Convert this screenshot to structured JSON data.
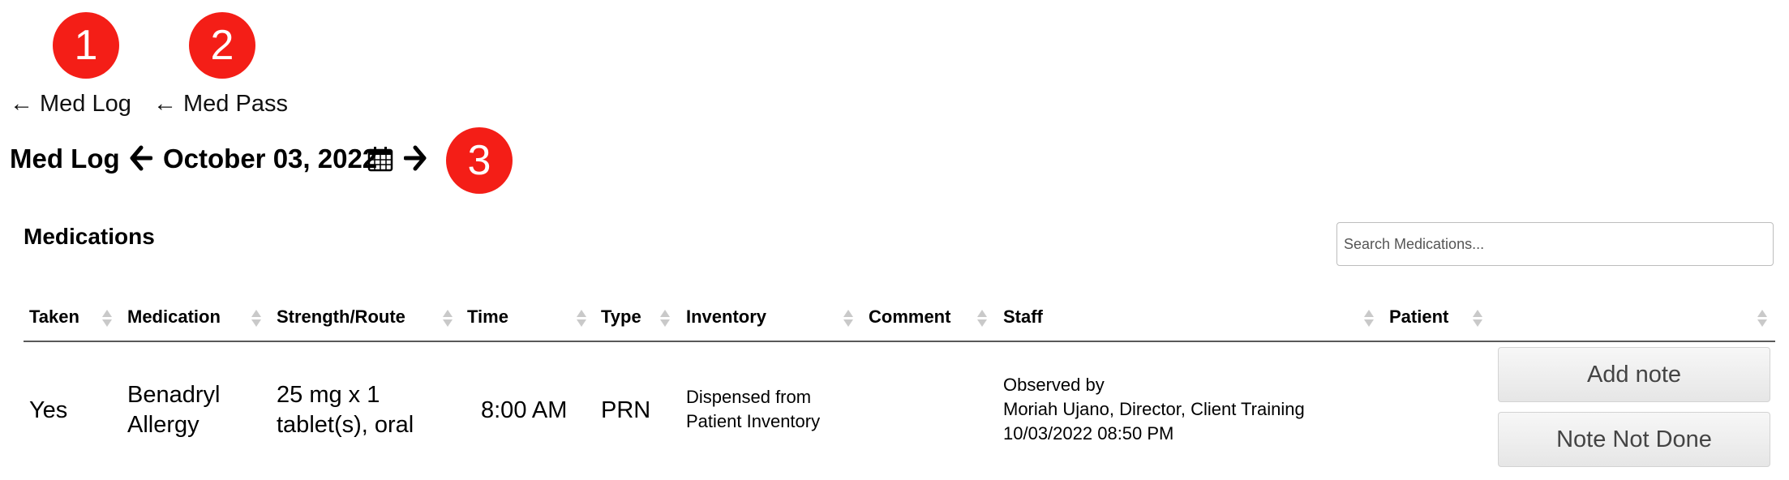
{
  "markers": [
    "1",
    "2",
    "3"
  ],
  "back_links": [
    {
      "arrow": "←",
      "label": "Med Log"
    },
    {
      "arrow": "←",
      "label": "Med Pass"
    }
  ],
  "header": {
    "title": "Med Log",
    "date": "October 03, 2022"
  },
  "medications": {
    "title": "Medications",
    "search_placeholder": "Search Medications...",
    "columns": [
      "Taken",
      "Medication",
      "Strength/Route",
      "Time",
      "Type",
      "Inventory",
      "Comment",
      "Staff",
      "Patient",
      ""
    ],
    "rows": [
      {
        "taken": "Yes",
        "medication": [
          "Benadryl",
          "Allergy"
        ],
        "strength": [
          "25 mg x 1",
          "tablet(s), oral"
        ],
        "time": "8:00 AM",
        "type": "PRN",
        "inventory": [
          "Dispensed from",
          "Patient Inventory"
        ],
        "comment": "",
        "staff": [
          "Observed by",
          "Moriah Ujano, Director, Client Training",
          "10/03/2022 08:50 PM"
        ],
        "patient": "",
        "actions": [
          "Add note",
          "Note Not Done"
        ]
      }
    ]
  },
  "colors": {
    "marker": "#f41e17",
    "header_rule": "#5a5a5a",
    "sort_arrow": "#c9c9c9"
  },
  "icons": [
    "left-arrow-icon",
    "right-arrow-icon",
    "calendar-icon",
    "sort-icon"
  ]
}
